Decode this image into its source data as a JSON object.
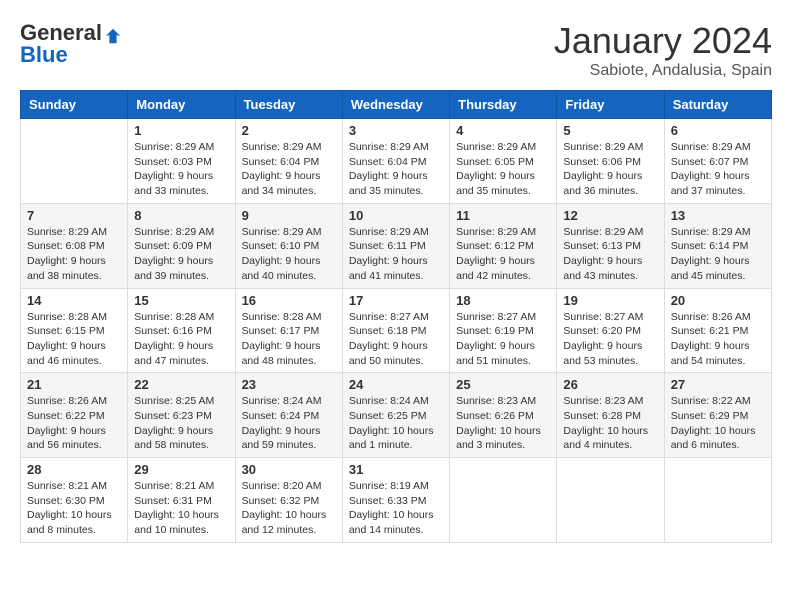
{
  "header": {
    "logo_general": "General",
    "logo_blue": "Blue",
    "month_title": "January 2024",
    "location": "Sabiote, Andalusia, Spain"
  },
  "weekdays": [
    "Sunday",
    "Monday",
    "Tuesday",
    "Wednesday",
    "Thursday",
    "Friday",
    "Saturday"
  ],
  "weeks": [
    [
      {
        "day": "",
        "sunrise": "",
        "sunset": "",
        "daylight": ""
      },
      {
        "day": "1",
        "sunrise": "Sunrise: 8:29 AM",
        "sunset": "Sunset: 6:03 PM",
        "daylight": "Daylight: 9 hours and 33 minutes."
      },
      {
        "day": "2",
        "sunrise": "Sunrise: 8:29 AM",
        "sunset": "Sunset: 6:04 PM",
        "daylight": "Daylight: 9 hours and 34 minutes."
      },
      {
        "day": "3",
        "sunrise": "Sunrise: 8:29 AM",
        "sunset": "Sunset: 6:04 PM",
        "daylight": "Daylight: 9 hours and 35 minutes."
      },
      {
        "day": "4",
        "sunrise": "Sunrise: 8:29 AM",
        "sunset": "Sunset: 6:05 PM",
        "daylight": "Daylight: 9 hours and 35 minutes."
      },
      {
        "day": "5",
        "sunrise": "Sunrise: 8:29 AM",
        "sunset": "Sunset: 6:06 PM",
        "daylight": "Daylight: 9 hours and 36 minutes."
      },
      {
        "day": "6",
        "sunrise": "Sunrise: 8:29 AM",
        "sunset": "Sunset: 6:07 PM",
        "daylight": "Daylight: 9 hours and 37 minutes."
      }
    ],
    [
      {
        "day": "7",
        "sunrise": "",
        "sunset": "",
        "daylight": ""
      },
      {
        "day": "8",
        "sunrise": "Sunrise: 8:29 AM",
        "sunset": "Sunset: 6:09 PM",
        "daylight": "Daylight: 9 hours and 39 minutes."
      },
      {
        "day": "9",
        "sunrise": "Sunrise: 8:29 AM",
        "sunset": "Sunset: 6:10 PM",
        "daylight": "Daylight: 9 hours and 40 minutes."
      },
      {
        "day": "10",
        "sunrise": "Sunrise: 8:29 AM",
        "sunset": "Sunset: 6:11 PM",
        "daylight": "Daylight: 9 hours and 41 minutes."
      },
      {
        "day": "11",
        "sunrise": "Sunrise: 8:29 AM",
        "sunset": "Sunset: 6:12 PM",
        "daylight": "Daylight: 9 hours and 42 minutes."
      },
      {
        "day": "12",
        "sunrise": "Sunrise: 8:29 AM",
        "sunset": "Sunset: 6:13 PM",
        "daylight": "Daylight: 9 hours and 43 minutes."
      },
      {
        "day": "13",
        "sunrise": "Sunrise: 8:29 AM",
        "sunset": "Sunset: 6:14 PM",
        "daylight": "Daylight: 9 hours and 45 minutes."
      }
    ],
    [
      {
        "day": "14",
        "sunrise": "",
        "sunset": "",
        "daylight": ""
      },
      {
        "day": "15",
        "sunrise": "Sunrise: 8:28 AM",
        "sunset": "Sunset: 6:16 PM",
        "daylight": "Daylight: 9 hours and 47 minutes."
      },
      {
        "day": "16",
        "sunrise": "Sunrise: 8:28 AM",
        "sunset": "Sunset: 6:17 PM",
        "daylight": "Daylight: 9 hours and 48 minutes."
      },
      {
        "day": "17",
        "sunrise": "Sunrise: 8:27 AM",
        "sunset": "Sunset: 6:18 PM",
        "daylight": "Daylight: 9 hours and 50 minutes."
      },
      {
        "day": "18",
        "sunrise": "Sunrise: 8:27 AM",
        "sunset": "Sunset: 6:19 PM",
        "daylight": "Daylight: 9 hours and 51 minutes."
      },
      {
        "day": "19",
        "sunrise": "Sunrise: 8:27 AM",
        "sunset": "Sunset: 6:20 PM",
        "daylight": "Daylight: 9 hours and 53 minutes."
      },
      {
        "day": "20",
        "sunrise": "Sunrise: 8:26 AM",
        "sunset": "Sunset: 6:21 PM",
        "daylight": "Daylight: 9 hours and 54 minutes."
      }
    ],
    [
      {
        "day": "21",
        "sunrise": "",
        "sunset": "",
        "daylight": ""
      },
      {
        "day": "22",
        "sunrise": "Sunrise: 8:25 AM",
        "sunset": "Sunset: 6:23 PM",
        "daylight": "Daylight: 9 hours and 58 minutes."
      },
      {
        "day": "23",
        "sunrise": "Sunrise: 8:24 AM",
        "sunset": "Sunset: 6:24 PM",
        "daylight": "Daylight: 9 hours and 59 minutes."
      },
      {
        "day": "24",
        "sunrise": "Sunrise: 8:24 AM",
        "sunset": "Sunset: 6:25 PM",
        "daylight": "Daylight: 10 hours and 1 minute."
      },
      {
        "day": "25",
        "sunrise": "Sunrise: 8:23 AM",
        "sunset": "Sunset: 6:26 PM",
        "daylight": "Daylight: 10 hours and 3 minutes."
      },
      {
        "day": "26",
        "sunrise": "Sunrise: 8:23 AM",
        "sunset": "Sunset: 6:28 PM",
        "daylight": "Daylight: 10 hours and 4 minutes."
      },
      {
        "day": "27",
        "sunrise": "Sunrise: 8:22 AM",
        "sunset": "Sunset: 6:29 PM",
        "daylight": "Daylight: 10 hours and 6 minutes."
      }
    ],
    [
      {
        "day": "28",
        "sunrise": "",
        "sunset": "",
        "daylight": ""
      },
      {
        "day": "29",
        "sunrise": "Sunrise: 8:21 AM",
        "sunset": "Sunset: 6:31 PM",
        "daylight": "Daylight: 10 hours and 10 minutes."
      },
      {
        "day": "30",
        "sunrise": "Sunrise: 8:20 AM",
        "sunset": "Sunset: 6:32 PM",
        "daylight": "Daylight: 10 hours and 12 minutes."
      },
      {
        "day": "31",
        "sunrise": "Sunrise: 8:19 AM",
        "sunset": "Sunset: 6:33 PM",
        "daylight": "Daylight: 10 hours and 14 minutes."
      },
      {
        "day": "",
        "sunrise": "",
        "sunset": "",
        "daylight": ""
      },
      {
        "day": "",
        "sunrise": "",
        "sunset": "",
        "daylight": ""
      },
      {
        "day": "",
        "sunrise": "",
        "sunset": "",
        "daylight": ""
      }
    ]
  ],
  "week1_sunday": {
    "sunrise": "Sunrise: 8:29 AM",
    "sunset": "Sunset: 6:08 PM",
    "daylight": "Daylight: 9 hours and 38 minutes."
  },
  "week2_sunday": {
    "sunrise": "Sunrise: 8:29 AM",
    "sunset": "Sunset: 6:08 PM",
    "daylight": "Daylight: 9 hours and 38 minutes."
  },
  "week3_sunday": {
    "sunrise": "Sunrise: 8:28 AM",
    "sunset": "Sunset: 6:15 PM",
    "daylight": "Daylight: 9 hours and 46 minutes."
  },
  "week4_sunday": {
    "sunrise": "Sunrise: 8:26 AM",
    "sunset": "Sunset: 6:22 PM",
    "daylight": "Daylight: 9 hours and 56 minutes."
  },
  "week5_sunday": {
    "sunrise": "Sunrise: 8:21 AM",
    "sunset": "Sunset: 6:30 PM",
    "daylight": "Daylight: 10 hours and 8 minutes."
  }
}
